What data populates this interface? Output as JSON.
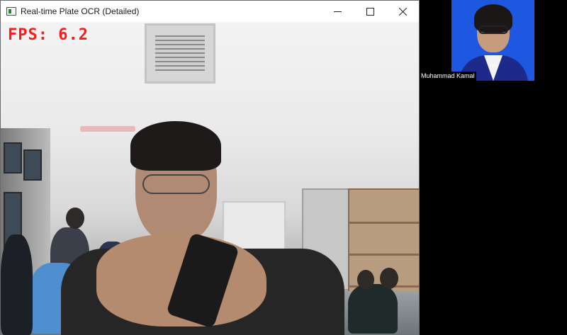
{
  "window": {
    "title": "Real-time Plate OCR (Detailed)",
    "controls": {
      "minimize": "minimize-icon",
      "maximize": "maximize-icon",
      "close": "close-icon"
    }
  },
  "overlay": {
    "fps_text": "FPS: 6.2",
    "fps_color": "#ff1a1a"
  },
  "participant": {
    "name": "Muhammad Kamal",
    "tile_background": "#1f58e0"
  }
}
